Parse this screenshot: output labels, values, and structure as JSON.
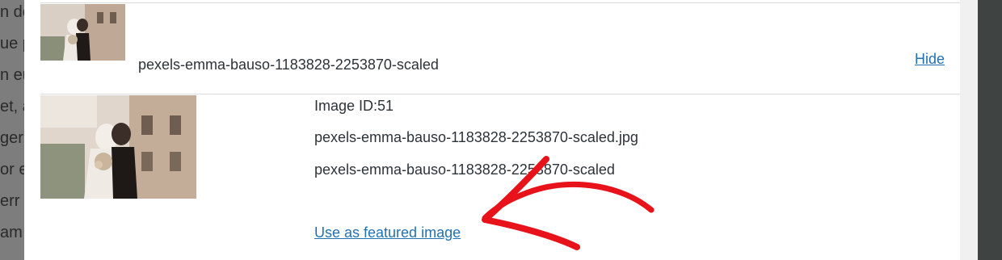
{
  "background_page": {
    "text_fragments": [
      "n do",
      "ue p",
      "n eu",
      "et, a",
      "ger",
      "or e",
      "err",
      "am"
    ]
  },
  "attachment": {
    "title": "pexels-emma-bauso-1183828-2253870-scaled",
    "hide_label": "Hide"
  },
  "details": {
    "image_id": "Image ID:51",
    "file_name": "pexels-emma-bauso-1183828-2253870-scaled.jpg",
    "title": "pexels-emma-bauso-1183828-2253870-scaled",
    "featured_link": "Use as featured image"
  },
  "colors": {
    "link": "#2271b1",
    "annotation_arrow": "#e8121b"
  },
  "icons": [
    "annotation-arrow"
  ]
}
